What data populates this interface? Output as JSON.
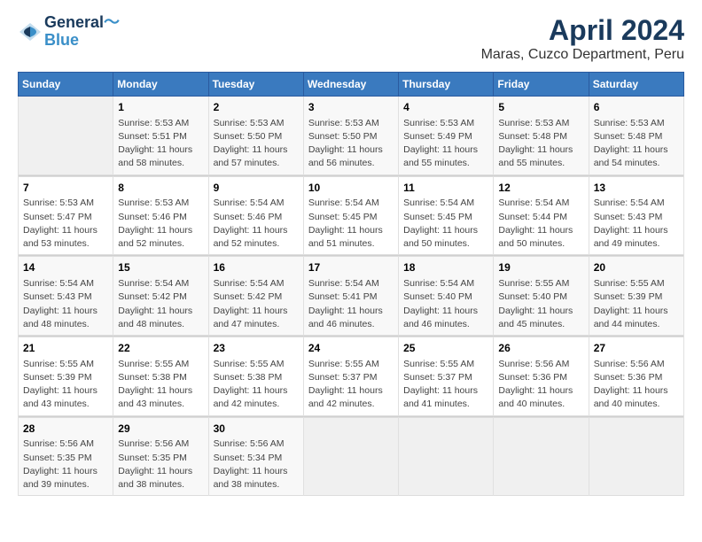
{
  "header": {
    "logo_line1": "General",
    "logo_line2": "Blue",
    "main_title": "April 2024",
    "subtitle": "Maras, Cuzco Department, Peru"
  },
  "columns": [
    "Sunday",
    "Monday",
    "Tuesday",
    "Wednesday",
    "Thursday",
    "Friday",
    "Saturday"
  ],
  "weeks": [
    [
      {
        "num": "",
        "info": ""
      },
      {
        "num": "1",
        "info": "Sunrise: 5:53 AM\nSunset: 5:51 PM\nDaylight: 11 hours\nand 58 minutes."
      },
      {
        "num": "2",
        "info": "Sunrise: 5:53 AM\nSunset: 5:50 PM\nDaylight: 11 hours\nand 57 minutes."
      },
      {
        "num": "3",
        "info": "Sunrise: 5:53 AM\nSunset: 5:50 PM\nDaylight: 11 hours\nand 56 minutes."
      },
      {
        "num": "4",
        "info": "Sunrise: 5:53 AM\nSunset: 5:49 PM\nDaylight: 11 hours\nand 55 minutes."
      },
      {
        "num": "5",
        "info": "Sunrise: 5:53 AM\nSunset: 5:48 PM\nDaylight: 11 hours\nand 55 minutes."
      },
      {
        "num": "6",
        "info": "Sunrise: 5:53 AM\nSunset: 5:48 PM\nDaylight: 11 hours\nand 54 minutes."
      }
    ],
    [
      {
        "num": "7",
        "info": "Sunrise: 5:53 AM\nSunset: 5:47 PM\nDaylight: 11 hours\nand 53 minutes."
      },
      {
        "num": "8",
        "info": "Sunrise: 5:53 AM\nSunset: 5:46 PM\nDaylight: 11 hours\nand 52 minutes."
      },
      {
        "num": "9",
        "info": "Sunrise: 5:54 AM\nSunset: 5:46 PM\nDaylight: 11 hours\nand 52 minutes."
      },
      {
        "num": "10",
        "info": "Sunrise: 5:54 AM\nSunset: 5:45 PM\nDaylight: 11 hours\nand 51 minutes."
      },
      {
        "num": "11",
        "info": "Sunrise: 5:54 AM\nSunset: 5:45 PM\nDaylight: 11 hours\nand 50 minutes."
      },
      {
        "num": "12",
        "info": "Sunrise: 5:54 AM\nSunset: 5:44 PM\nDaylight: 11 hours\nand 50 minutes."
      },
      {
        "num": "13",
        "info": "Sunrise: 5:54 AM\nSunset: 5:43 PM\nDaylight: 11 hours\nand 49 minutes."
      }
    ],
    [
      {
        "num": "14",
        "info": "Sunrise: 5:54 AM\nSunset: 5:43 PM\nDaylight: 11 hours\nand 48 minutes."
      },
      {
        "num": "15",
        "info": "Sunrise: 5:54 AM\nSunset: 5:42 PM\nDaylight: 11 hours\nand 48 minutes."
      },
      {
        "num": "16",
        "info": "Sunrise: 5:54 AM\nSunset: 5:42 PM\nDaylight: 11 hours\nand 47 minutes."
      },
      {
        "num": "17",
        "info": "Sunrise: 5:54 AM\nSunset: 5:41 PM\nDaylight: 11 hours\nand 46 minutes."
      },
      {
        "num": "18",
        "info": "Sunrise: 5:54 AM\nSunset: 5:40 PM\nDaylight: 11 hours\nand 46 minutes."
      },
      {
        "num": "19",
        "info": "Sunrise: 5:55 AM\nSunset: 5:40 PM\nDaylight: 11 hours\nand 45 minutes."
      },
      {
        "num": "20",
        "info": "Sunrise: 5:55 AM\nSunset: 5:39 PM\nDaylight: 11 hours\nand 44 minutes."
      }
    ],
    [
      {
        "num": "21",
        "info": "Sunrise: 5:55 AM\nSunset: 5:39 PM\nDaylight: 11 hours\nand 43 minutes."
      },
      {
        "num": "22",
        "info": "Sunrise: 5:55 AM\nSunset: 5:38 PM\nDaylight: 11 hours\nand 43 minutes."
      },
      {
        "num": "23",
        "info": "Sunrise: 5:55 AM\nSunset: 5:38 PM\nDaylight: 11 hours\nand 42 minutes."
      },
      {
        "num": "24",
        "info": "Sunrise: 5:55 AM\nSunset: 5:37 PM\nDaylight: 11 hours\nand 42 minutes."
      },
      {
        "num": "25",
        "info": "Sunrise: 5:55 AM\nSunset: 5:37 PM\nDaylight: 11 hours\nand 41 minutes."
      },
      {
        "num": "26",
        "info": "Sunrise: 5:56 AM\nSunset: 5:36 PM\nDaylight: 11 hours\nand 40 minutes."
      },
      {
        "num": "27",
        "info": "Sunrise: 5:56 AM\nSunset: 5:36 PM\nDaylight: 11 hours\nand 40 minutes."
      }
    ],
    [
      {
        "num": "28",
        "info": "Sunrise: 5:56 AM\nSunset: 5:35 PM\nDaylight: 11 hours\nand 39 minutes."
      },
      {
        "num": "29",
        "info": "Sunrise: 5:56 AM\nSunset: 5:35 PM\nDaylight: 11 hours\nand 38 minutes."
      },
      {
        "num": "30",
        "info": "Sunrise: 5:56 AM\nSunset: 5:34 PM\nDaylight: 11 hours\nand 38 minutes."
      },
      {
        "num": "",
        "info": ""
      },
      {
        "num": "",
        "info": ""
      },
      {
        "num": "",
        "info": ""
      },
      {
        "num": "",
        "info": ""
      }
    ]
  ]
}
